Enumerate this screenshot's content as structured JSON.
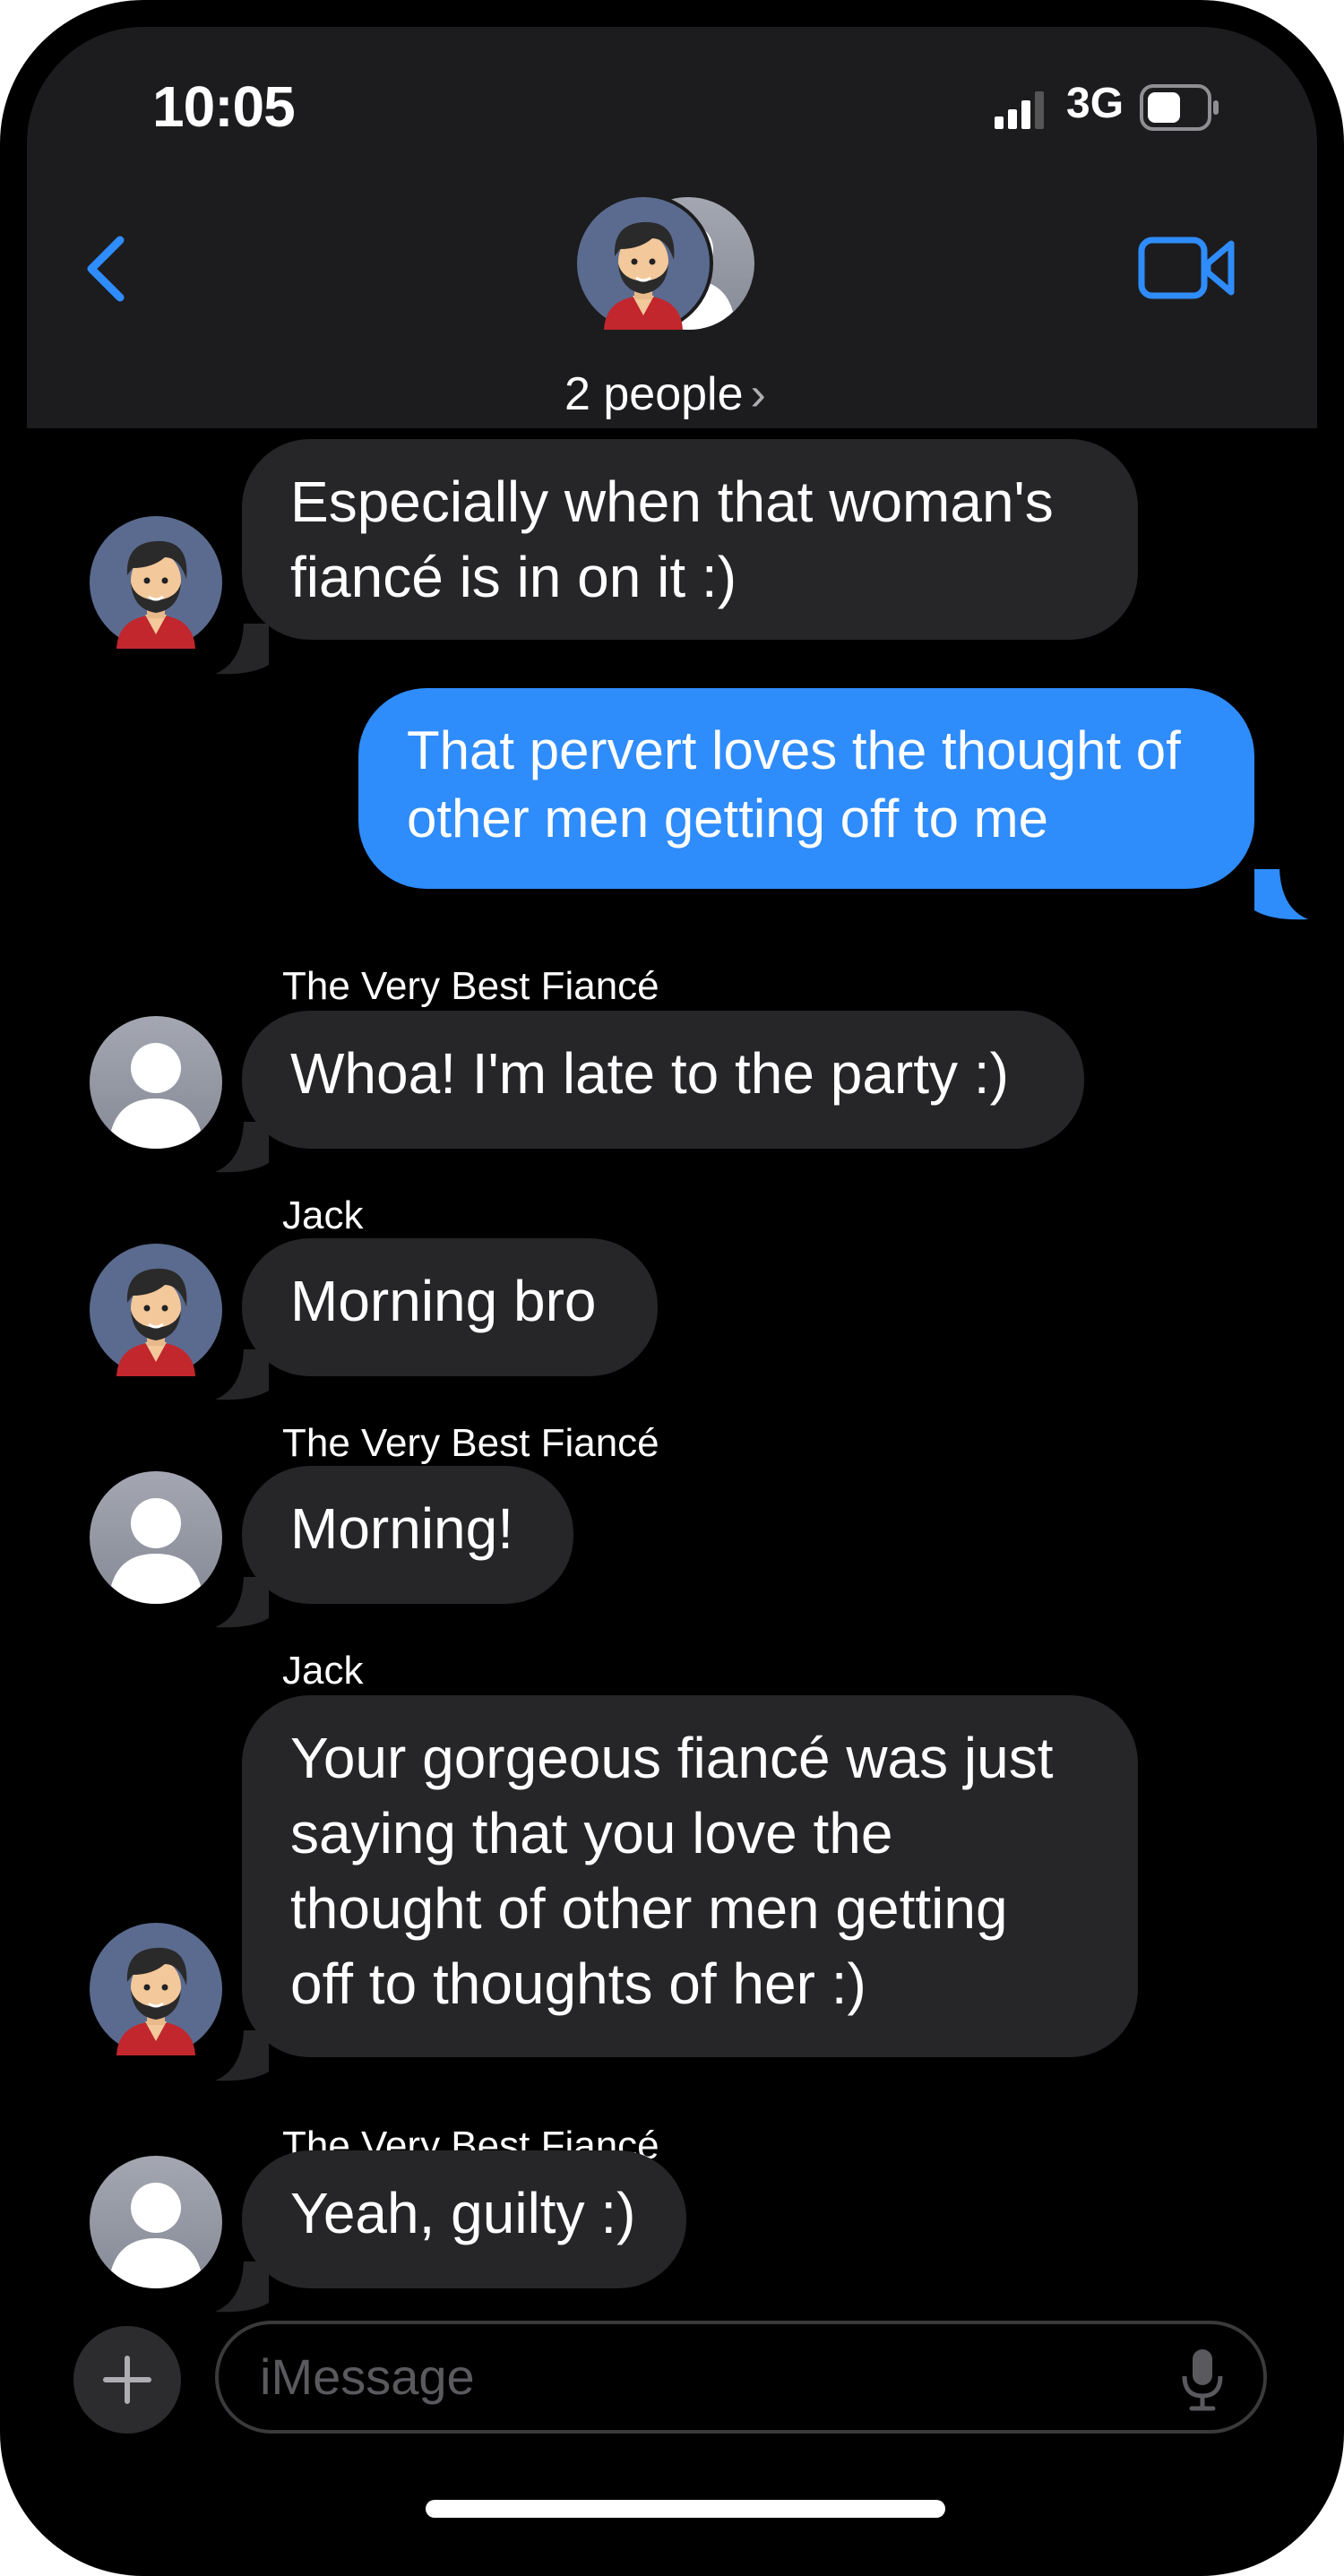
{
  "status_bar": {
    "time": "10:05",
    "network": "3G"
  },
  "header": {
    "group_label": "2 people",
    "chevron": "›"
  },
  "icons": {
    "back": "chevron-left-icon",
    "video": "video-camera-icon",
    "add": "plus-icon",
    "mic": "microphone-icon"
  },
  "colors": {
    "accent_blue": "#2f8cfb",
    "incoming_bubble": "#262628",
    "header_bg": "#1c1c1e"
  },
  "messages": [
    {
      "from": "incoming",
      "sender": "",
      "lines": [
        "Especially when that woman's",
        "fiancé is in on it :)"
      ]
    },
    {
      "from": "outgoing",
      "sender": "",
      "lines": [
        "That pervert loves the thought of",
        "other men getting off to me"
      ]
    },
    {
      "from": "incoming",
      "sender": "The Very Best Fiancé",
      "lines": [
        "Whoa!  I'm late to the party :)"
      ]
    },
    {
      "from": "incoming",
      "sender": "Jack",
      "lines": [
        "Morning bro"
      ]
    },
    {
      "from": "incoming",
      "sender": "The Very Best Fiancé",
      "lines": [
        "Morning!"
      ]
    },
    {
      "from": "incoming",
      "sender": "Jack",
      "lines": [
        "Your gorgeous fiancé was just",
        "saying that you love the",
        "thought of other men getting",
        "off to thoughts of her :)"
      ]
    },
    {
      "from": "incoming",
      "sender": "The Very Best Fiancé",
      "lines": [
        "Yeah, guilty :)"
      ]
    }
  ],
  "compose": {
    "placeholder": "iMessage"
  }
}
